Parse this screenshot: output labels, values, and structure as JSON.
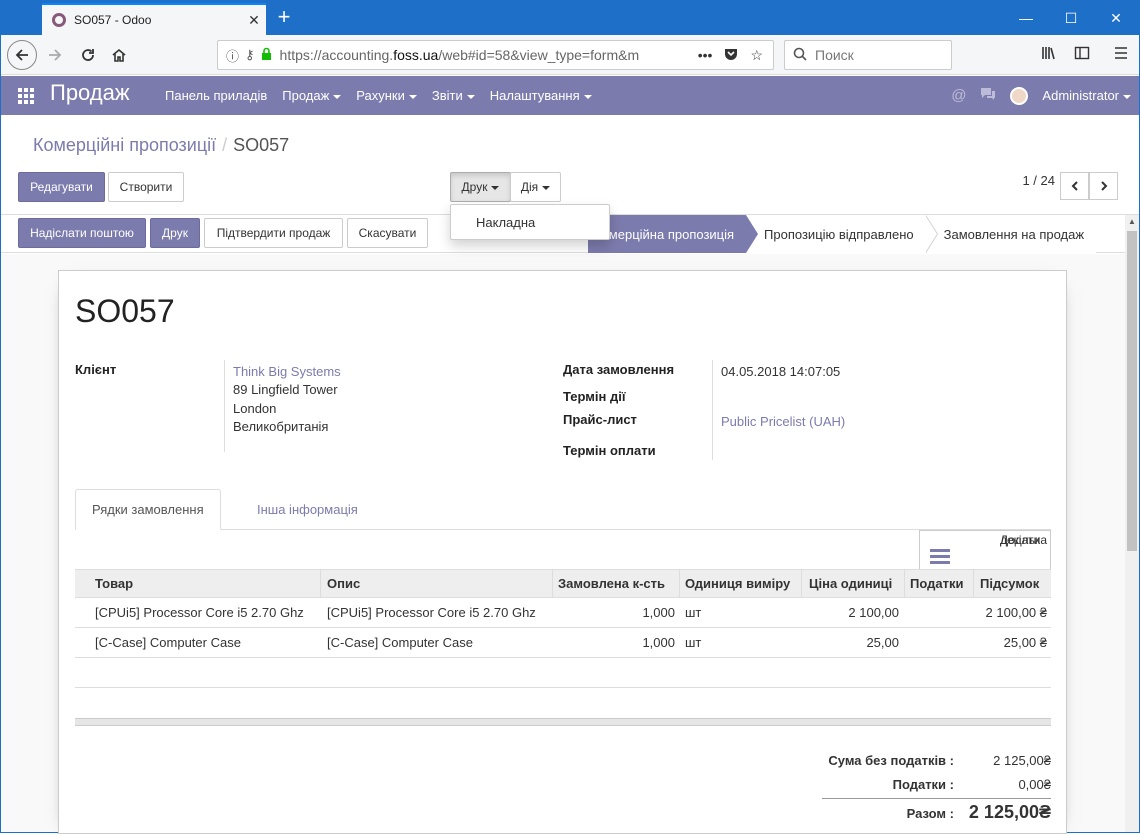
{
  "browser": {
    "tab_title": "SO057 - Odoo",
    "tab_close": "✕",
    "new_tab": "+",
    "url_prefix": "https://accounting.",
    "url_domain": "foss.ua",
    "url_suffix": "/web#id=58&view_type=form&m",
    "url_more": "•••",
    "search_placeholder": "Поиск",
    "window_minimize": "—",
    "window_maximize": "☐",
    "window_close": "✕"
  },
  "app_nav": {
    "brand": "Продаж",
    "menu": [
      "Панель приладів",
      "Продаж",
      "Рахунки",
      "Звіти",
      "Налаштування"
    ],
    "user": "Administrator"
  },
  "breadcrumb": {
    "parent": "Комерційні пропозиції",
    "separator": "/",
    "current": "SO057"
  },
  "control": {
    "edit": "Редагувати",
    "create": "Створити",
    "print": "Друк",
    "action": "Дія",
    "pager": "1 / 24"
  },
  "print_menu": {
    "items": [
      "Накладна"
    ]
  },
  "statusbar": {
    "buttons": [
      "Надіслати поштою",
      "Друк",
      "Підтвердити продаж",
      "Скасувати"
    ],
    "stages": [
      "Комерційна пропозиція",
      "Пропозицію відправлено",
      "Замовлення на продаж"
    ],
    "active_stage": "Комерційна пропозиція"
  },
  "form": {
    "name": "SO057",
    "customer_label": "Клієнт",
    "customer_name": "Think Big Systems",
    "customer_address": [
      "89 Lingfield Tower",
      "London",
      "Великобританія"
    ],
    "order_date_label": "Дата замовлення",
    "order_date": "04.05.2018 14:07:05",
    "validity_label": "Термін дії",
    "pricelist_label": "Прайс-лист",
    "pricelist": "Public Pricelist (UAH)",
    "payment_terms_label": "Термін оплати"
  },
  "tabs": [
    "Рядки замовлення",
    "Інша інформація"
  ],
  "add_multiple": [
    "Додати",
    "декілька"
  ],
  "order_lines": {
    "columns": [
      "Товар",
      "Опис",
      "Замовлена к-сть",
      "Одиниця виміру",
      "Ціна одиниці",
      "Податки",
      "Підсумок"
    ],
    "rows": [
      {
        "product": "[CPUi5] Processor Core i5 2.70 Ghz",
        "description": "[CPUi5] Processor Core i5 2.70 Ghz",
        "qty": "1,000",
        "uom": "шт",
        "price": "2 100,00",
        "taxes": "",
        "subtotal": "2 100,00 ₴"
      },
      {
        "product": "[C-Case] Computer Case",
        "description": "[C-Case] Computer Case",
        "qty": "1,000",
        "uom": "шт",
        "price": "25,00",
        "taxes": "",
        "subtotal": "25,00 ₴"
      }
    ]
  },
  "totals": {
    "untaxed_label": "Сума без податків :",
    "untaxed": "2 125,00₴",
    "taxes_label": "Податки :",
    "taxes": "0,00₴",
    "total_label": "Разом :",
    "total": "2 125,00₴"
  },
  "colors": {
    "odoo_purple": "#7c7bad",
    "browser_blue": "#1e6fc8"
  }
}
